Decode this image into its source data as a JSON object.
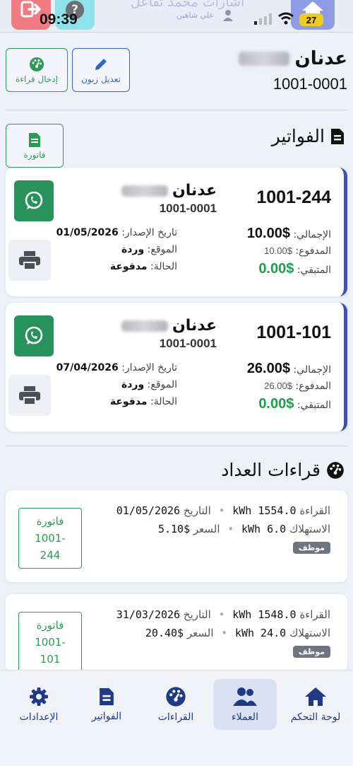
{
  "status_bar": {
    "time": "09:39",
    "battery": "27",
    "ghost_title": "اشارات محمد تفاعل",
    "ghost_sub": "علي شاهين",
    "icons": [
      "logout-icon",
      "help-icon",
      "home-icon",
      "signal-icon",
      "wifi-icon",
      "battery-icon"
    ]
  },
  "customer": {
    "name_first": "عدنان",
    "number": "1001-0001",
    "edit_label": "تعديل زبون",
    "enter_reading_label": "إدخال قراءة"
  },
  "invoices_section": {
    "title": "الفواتير",
    "add_invoice_label": "فاتورة",
    "labels": {
      "total": "الإجمالي:",
      "paid": "المدفوع:",
      "remaining": "المتبقي:",
      "issue_date": "تاريخ الإصدار:",
      "location": "الموقع:",
      "status": "الحالة:"
    },
    "items": [
      {
        "number": "1001-244",
        "customer_name": "عدنان",
        "customer_number": "1001-0001",
        "total": "$10.00",
        "paid": "$10.00",
        "remaining": "$0.00",
        "issue_date": "01/05/2026",
        "location": "وردة",
        "status": "مدفوعة"
      },
      {
        "number": "1001-101",
        "customer_name": "عدنان",
        "customer_number": "1001-0001",
        "total": "$26.00",
        "paid": "$26.00",
        "remaining": "$0.00",
        "issue_date": "07/04/2026",
        "location": "وردة",
        "status": "مدفوعة"
      }
    ]
  },
  "readings_section": {
    "title": "قراءات العداد",
    "labels": {
      "reading": "القراءة",
      "date": "التاريخ",
      "consumption": "الاستهلاك",
      "price": "السعر",
      "staff": "موظف"
    },
    "items": [
      {
        "reading": "1554.0 kWh",
        "date": "01/05/2026",
        "consumption": "6.0 kWh",
        "price": "$5.10",
        "invoice_label": "فاتورة",
        "invoice_num_a": "1001-",
        "invoice_num_b": "244"
      },
      {
        "reading": "1548.0 kWh",
        "date": "31/03/2026",
        "consumption": "24.0 kWh",
        "price": "$20.40",
        "invoice_label": "فاتورة",
        "invoice_num_a": "1001-",
        "invoice_num_b": "101"
      }
    ]
  },
  "bottom_nav": {
    "items": [
      {
        "label": "لوحة التحكم",
        "icon": "home-icon"
      },
      {
        "label": "العملاء",
        "icon": "users-icon"
      },
      {
        "label": "القراءات",
        "icon": "gauge-icon"
      },
      {
        "label": "الفواتير",
        "icon": "invoice-icon"
      },
      {
        "label": "الإعدادات",
        "icon": "settings-icon"
      }
    ],
    "active": "العملاء"
  },
  "colors": {
    "primary_blue": "#2f66c8",
    "nav_blue": "#1f3b86",
    "green": "#27935a",
    "remaining_green": "#1f9d4c",
    "card_accent": "#3d4fc0"
  }
}
